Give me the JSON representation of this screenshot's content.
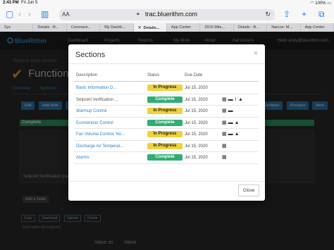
{
  "status_bar": {
    "time": "2:43 PM",
    "date": "Fri Jun 5",
    "battery": "100%"
  },
  "safari": {
    "text_size_label": "AA",
    "url": "trac.bluerithm.com",
    "back_icon": "chevron-left-icon",
    "forward_icon": "chevron-right-icon",
    "bookmarks_icon": "book-icon",
    "share_icon": "share-icon",
    "new_tab_icon": "plus-icon",
    "tabs_icon": "tabs-grid-icon"
  },
  "browser_tabs": [
    {
      "label": "Sys",
      "active": false
    },
    {
      "label": "Details - B...",
      "active": false
    },
    {
      "label": "Coronavir...",
      "active": false
    },
    {
      "label": "My Dashb...",
      "active": false
    },
    {
      "label": "Details...",
      "active": true
    },
    {
      "label": "App Center",
      "active": false
    },
    {
      "label": "2015 Mits...",
      "active": false
    },
    {
      "label": "Details - B...",
      "active": false
    },
    {
      "label": "Narcos: M...",
      "active": false
    },
    {
      "label": "App Center",
      "active": false
    }
  ],
  "app": {
    "logo": "BlueRithm",
    "nav": [
      "Dashboard",
      "Projects",
      "Reports",
      "My Work",
      "About",
      "Get Access"
    ],
    "user": "Hello andy@bluerithm.com",
    "breadcrumb": "TERADIS DATA CENTER",
    "page_title": "Functional",
    "sub_tabs": [
      "Overview",
      "Systems"
    ],
    "buttons_left": [
      "Edit",
      "Add Note",
      "Du"
    ],
    "buttons_right": [
      "Sections",
      "Previous",
      "Next"
    ],
    "complete_bar": "Complete",
    "setpoint_text": "Setpoint Verification (con",
    "add_table": "Add a Table",
    "tool_buttons": [
      "Copy",
      "Download",
      "Upload",
      "Delete"
    ],
    "table_desc": "[add table description]",
    "value_headers": [
      "Value as",
      "Value"
    ]
  },
  "modal": {
    "title": "Sections",
    "columns": {
      "description": "Description",
      "status": "Status",
      "due_date": "Due Date"
    },
    "rows": [
      {
        "name": "Basic Information D...",
        "link": true,
        "status": "In Progress",
        "status_type": "progress",
        "date": "Jul 15, 2020",
        "icons": []
      },
      {
        "name": "Setpoint Verification ...",
        "link": false,
        "status": "Complete",
        "status_type": "complete",
        "date": "Jul 15, 2020",
        "icons": [
          "table-icon",
          "comments-icon",
          "paperclip-icon",
          "warning-icon"
        ]
      },
      {
        "name": "Warmup Control",
        "link": true,
        "status": "In Progress",
        "status_type": "progress",
        "date": "Jul 15, 2020",
        "icons": [
          "table-icon",
          "comments-icon"
        ]
      },
      {
        "name": "Economizer Control",
        "link": true,
        "status": "Complete",
        "status_type": "complete",
        "date": "Jul 15, 2020",
        "icons": [
          "table-icon",
          "comments-icon",
          "warning-icon"
        ]
      },
      {
        "name": "Fan Volume Control, No...",
        "link": true,
        "status": "In Progress",
        "status_type": "progress",
        "date": "Jul 15, 2020",
        "icons": [
          "table-icon",
          "comments-icon",
          "warning-icon"
        ]
      },
      {
        "name": "Discharge Air Temperat...",
        "link": true,
        "status": "In Progress",
        "status_type": "progress",
        "date": "Jul 15, 2020",
        "icons": [
          "table-icon"
        ]
      },
      {
        "name": "Alarms",
        "link": true,
        "status": "Complete",
        "status_type": "complete",
        "date": "Jul 15, 2020",
        "icons": [
          "table-icon"
        ]
      }
    ],
    "close_label": "Close"
  },
  "colors": {
    "in_progress": "#f0d23c",
    "complete": "#2fae74",
    "link": "#2a7fc1",
    "accent": "#1b7cf2"
  }
}
